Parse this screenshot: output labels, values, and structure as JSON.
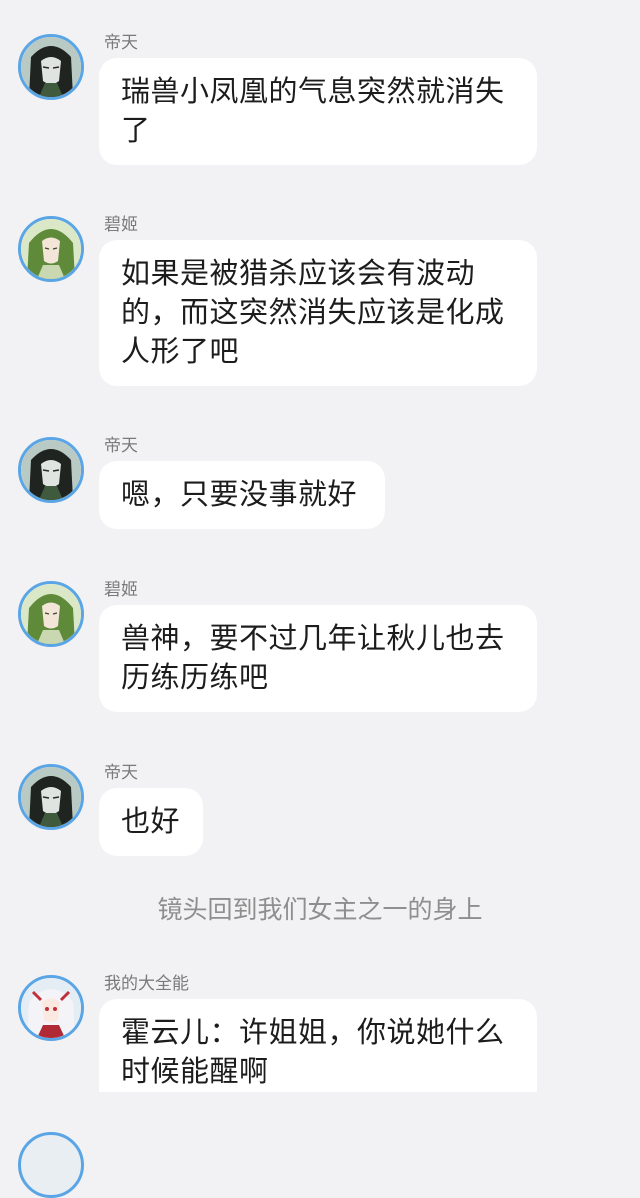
{
  "messages": [
    {
      "sender": "帝天",
      "avatar": "dark-haired-man-avatar",
      "text": "瑞兽小凤凰的气息突然就消失了"
    },
    {
      "sender": "碧姬",
      "avatar": "green-haired-woman-avatar",
      "text": "如果是被猎杀应该会有波动的，而这突然消失应该是化成人形了吧"
    },
    {
      "sender": "帝天",
      "avatar": "dark-haired-man-avatar",
      "text": "嗯，只要没事就好"
    },
    {
      "sender": "碧姬",
      "avatar": "green-haired-woman-avatar",
      "text": "兽神，要不过几年让秋儿也去历练历练吧"
    },
    {
      "sender": "帝天",
      "avatar": "dark-haired-man-avatar",
      "text": "也好"
    },
    {
      "sender": "我的大全能",
      "avatar": "white-haired-girl-avatar",
      "text": "霍云儿：许姐姐，你说她什么时候能醒啊"
    }
  ],
  "narration": "镜头回到我们女主之一的身上",
  "colors": {
    "background": "#f2f2f4",
    "bubble": "#ffffff",
    "avatar_ring": "#5aa5e6",
    "sender_text": "#7a7a7a",
    "narration_text": "#8e8e8e"
  }
}
